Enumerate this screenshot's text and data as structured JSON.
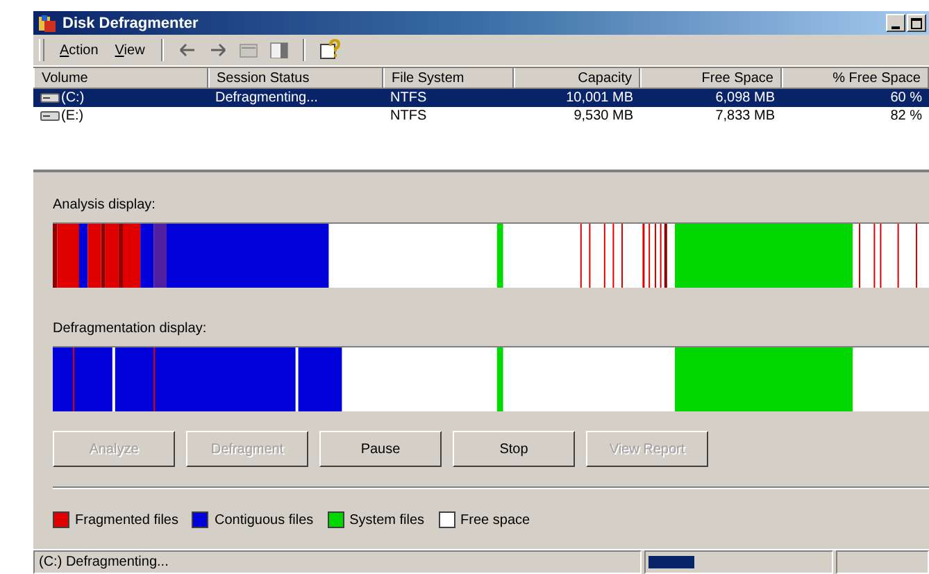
{
  "window": {
    "title": "Disk Defragmenter"
  },
  "menu": [
    {
      "label": "Action"
    },
    {
      "label": "View"
    }
  ],
  "table": {
    "columns": [
      {
        "label": "Volume"
      },
      {
        "label": "Session Status"
      },
      {
        "label": "File System"
      },
      {
        "label": "Capacity"
      },
      {
        "label": "Free Space"
      },
      {
        "label": "% Free Space"
      }
    ],
    "rows": [
      {
        "selected": true,
        "cells": [
          "(C:)",
          "Defragmenting...",
          "NTFS",
          "10,001 MB",
          "6,098 MB",
          "60 %"
        ]
      },
      {
        "selected": false,
        "cells": [
          "(E:)",
          "",
          "NTFS",
          "9,530 MB",
          "7,833 MB",
          "82 %"
        ]
      }
    ]
  },
  "analysis": {
    "label": "Analysis display:"
  },
  "defragmentation": {
    "label": "Defragmentation display:"
  },
  "buttons": [
    {
      "label": "Analyze",
      "disabled": true
    },
    {
      "label": "Defragment",
      "disabled": true
    },
    {
      "label": "Pause",
      "disabled": false
    },
    {
      "label": "Stop",
      "disabled": false
    },
    {
      "label": "View Report",
      "disabled": true
    }
  ],
  "legend": [
    {
      "label": "Fragmented files",
      "color": "#e00000"
    },
    {
      "label": "Contiguous files",
      "color": "#0000d8"
    },
    {
      "label": "System files",
      "color": "#00d800"
    },
    {
      "label": "Free space",
      "color": "#ffffff"
    }
  ],
  "status_bar": {
    "text": "(C:) Defragmenting...",
    "progress": {
      "level": 0.25
    }
  }
}
